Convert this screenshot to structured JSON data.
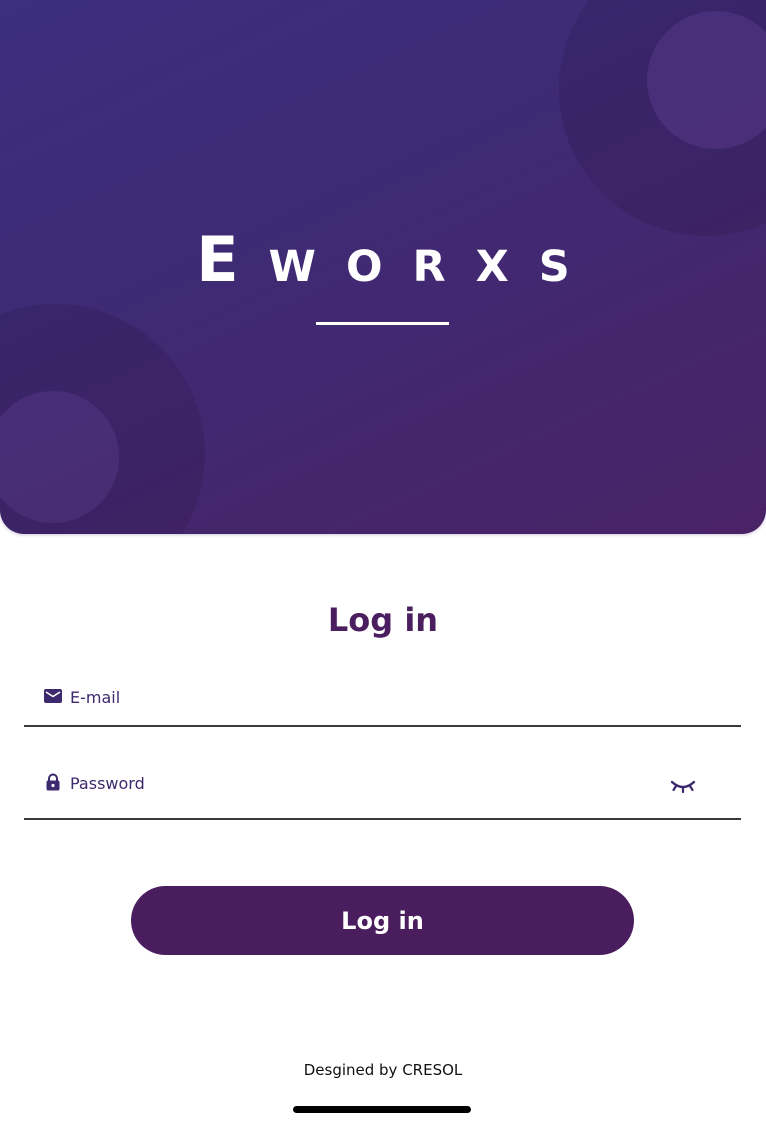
{
  "header": {
    "brand_name": "Eworxs"
  },
  "login": {
    "title": "Log in",
    "email": {
      "placeholder": "E-mail",
      "value": "",
      "icon": "mail-icon"
    },
    "password": {
      "placeholder": "Password",
      "value": "",
      "icon": "lock-icon",
      "toggle_icon": "eye-closed-icon"
    },
    "submit_label": "Log in"
  },
  "footer": {
    "credit": "Desgined by CRESOL"
  },
  "colors": {
    "brand_purple": "#4a1e5e",
    "header_gradient_start": "#3b2f7e",
    "header_gradient_end": "#4a2266",
    "icon_indigo": "#3d2a6e"
  }
}
